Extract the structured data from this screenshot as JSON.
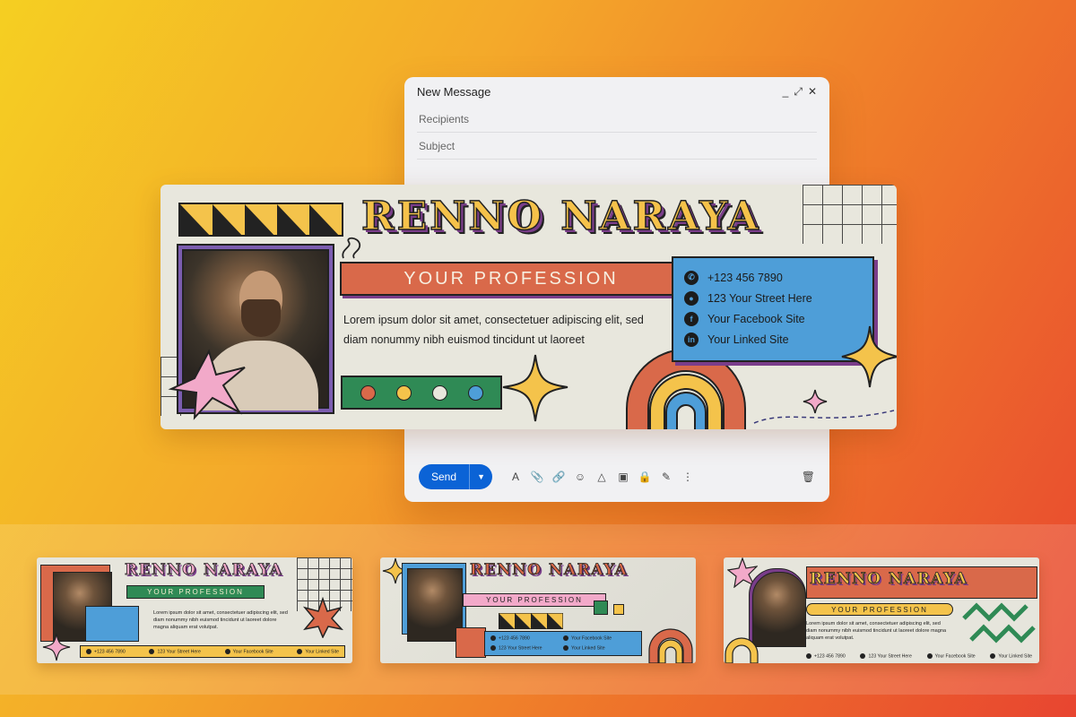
{
  "compose": {
    "title": "New Message",
    "controls": [
      "_",
      "⤢",
      "✕"
    ],
    "recipients_placeholder": "Recipients",
    "subject_placeholder": "Subject",
    "send_label": "Send",
    "send_dropdown": "▼",
    "tools": [
      "A",
      "📎",
      "🔗",
      "☺",
      "△",
      "▣",
      "🔒",
      "✎",
      "⋮"
    ],
    "trash": "🗑"
  },
  "signature": {
    "name": "RENNO NARAYA",
    "profession": "YOUR PROFESSION",
    "description": "Lorem ipsum dolor sit amet, consectetuer adipiscing elit, sed diam nonummy nibh euismod tincidunt ut laoreet",
    "phone": "+123 456 7890",
    "address": "123 Your Street Here",
    "facebook": "Your Facebook Site",
    "linkedin": "Your Linked Site",
    "dot_colors": [
      "#d9694a",
      "#f4c34b",
      "#e8e7dd",
      "#4e9ed8"
    ],
    "icons": [
      "whatsapp-icon",
      "location-pin-icon",
      "facebook-icon",
      "linkedin-icon"
    ]
  },
  "variants": [
    {
      "name": "RENNO NARAYA",
      "profession": "YOUR PROFESSION",
      "description": "Lorem ipsum dolor sit amet, consectetuer adipiscing elit, sed diam nonummy nibh euismod tincidunt ut laoreet dolore magna aliquam erat volutpat.",
      "phone": "+123 456 7890",
      "address": "123 Your Street Here",
      "facebook": "Your Facebook Site",
      "linkedin": "Your Linked Site"
    },
    {
      "name": "RENNO NARAYA",
      "profession": "YOUR PROFESSION",
      "phone": "+123 456 7890",
      "address": "123 Your Street Here",
      "facebook": "Your Facebook Site",
      "linkedin": "Your Linked Site"
    },
    {
      "name": "RENNO NARAYA",
      "profession": "YOUR PROFESSION",
      "description": "Lorem ipsum dolor sit amet, consectetuer adipiscing elit, sed diam nonummy nibh euismod tincidunt ut laoreet dolore magna aliquam erat volutpat.",
      "phone": "+123 456 7890",
      "address": "123 Your Street Here",
      "facebook": "Your Facebook Site",
      "linkedin": "Your Linked Site"
    }
  ],
  "colors": {
    "yellow": "#f4c34b",
    "orange": "#d9694a",
    "blue": "#4e9ed8",
    "green": "#2f8a55",
    "pink": "#f2a9c9",
    "purple": "#7a3d8a",
    "cream": "#e8e7dd",
    "send_blue": "#0b63d6"
  }
}
